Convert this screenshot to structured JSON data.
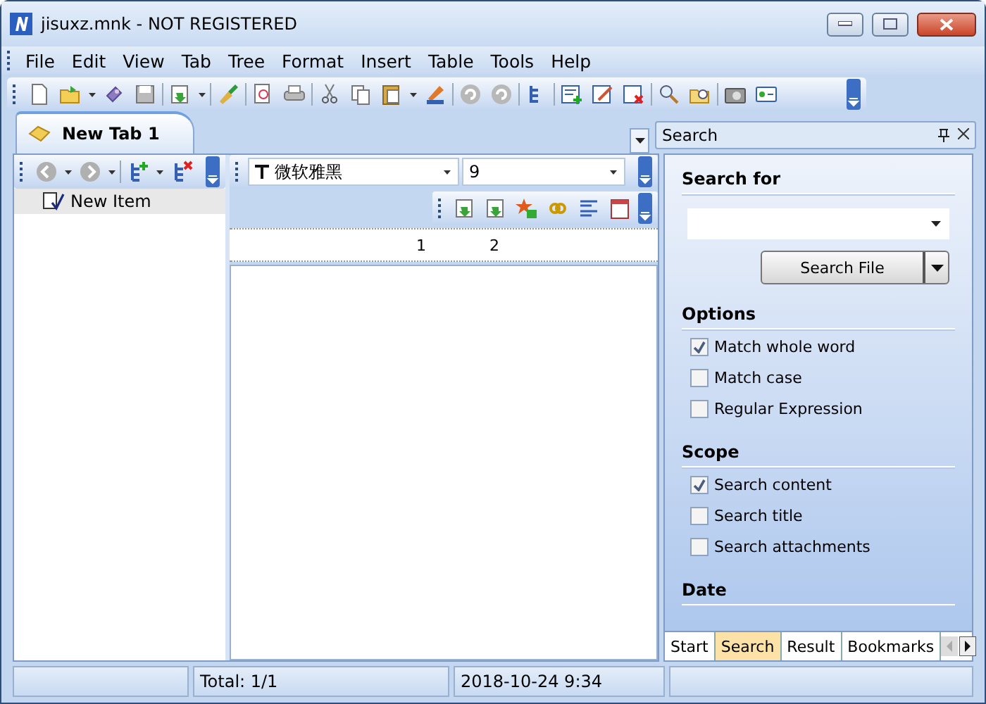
{
  "window": {
    "title": "jisuxz.mnk - NOT REGISTERED"
  },
  "menu": [
    "File",
    "Edit",
    "View",
    "Tab",
    "Tree",
    "Format",
    "Insert",
    "Table",
    "Tools",
    "Help"
  ],
  "tabs": [
    {
      "label": "New Tab 1",
      "selected": true
    }
  ],
  "tree": {
    "items": [
      {
        "label": "New Item",
        "selected": true
      }
    ]
  },
  "editor": {
    "font": "微软雅黑",
    "size": "9",
    "ruler_labels": [
      "1",
      "2"
    ]
  },
  "search_panel": {
    "title": "Search",
    "sections": [
      {
        "heading": "Search for",
        "kind": "query",
        "button": "Search File"
      },
      {
        "heading": "Options",
        "kind": "checks",
        "items": [
          {
            "label": "Match whole word",
            "checked": true
          },
          {
            "label": "Match case",
            "checked": false
          },
          {
            "label": "Regular Expression",
            "checked": false
          }
        ]
      },
      {
        "heading": "Scope",
        "kind": "checks",
        "items": [
          {
            "label": "Search content",
            "checked": true
          },
          {
            "label": "Search title",
            "checked": false
          },
          {
            "label": "Search attachments",
            "checked": false
          }
        ]
      },
      {
        "heading": "Date",
        "kind": "heading"
      }
    ],
    "tabs": [
      {
        "label": "Start",
        "selected": false
      },
      {
        "label": "Search",
        "selected": true
      },
      {
        "label": "Result",
        "selected": false
      },
      {
        "label": "Bookmarks",
        "selected": false
      }
    ]
  },
  "status_bar": [
    "Total: 1/1",
    "2018-10-24 9:34"
  ]
}
